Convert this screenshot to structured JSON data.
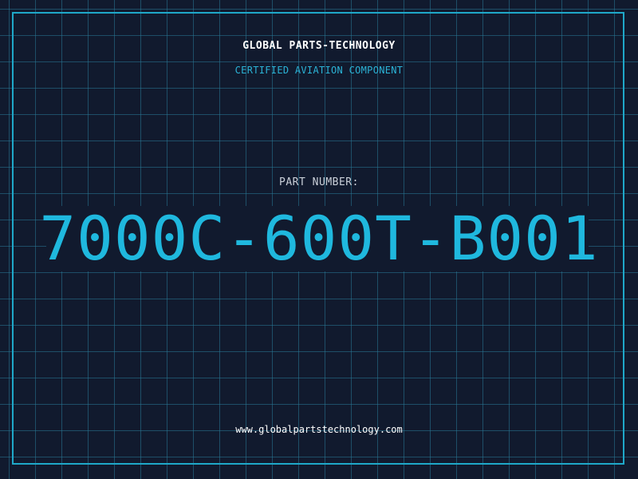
{
  "header": {
    "company_name": "GLOBAL PARTS-TECHNOLOGY",
    "tagline": "CERTIFIED AVIATION COMPONENT"
  },
  "part": {
    "label": "PART NUMBER:",
    "number": "7000C-600T-B001"
  },
  "footer": {
    "website": "www.globalpartstechnology.com"
  },
  "colors": {
    "background": "#111a2e",
    "grid": "#287896",
    "accent": "#1fb8de",
    "text_primary": "#ffffff",
    "text_secondary": "#c9cfd8"
  }
}
